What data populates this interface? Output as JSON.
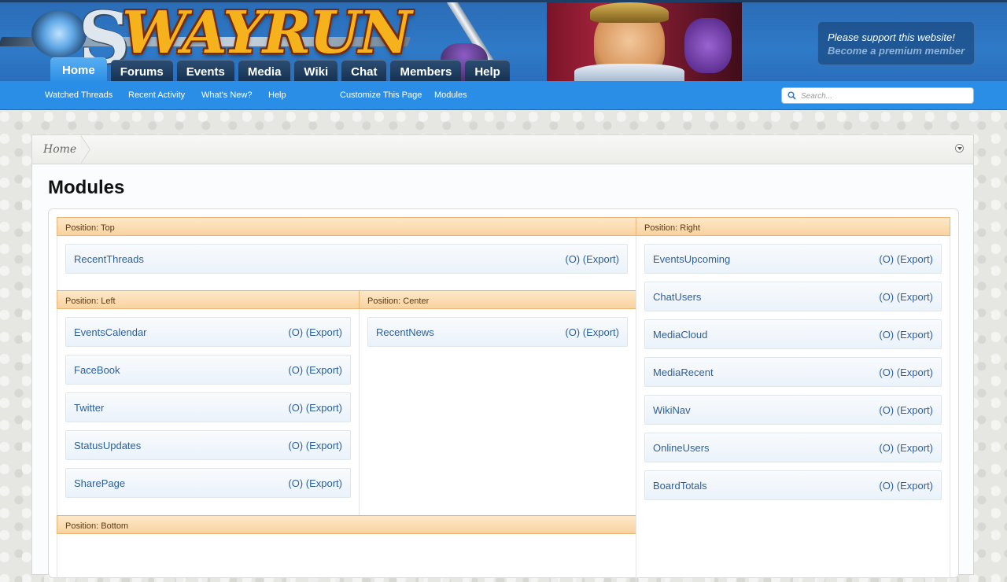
{
  "header": {
    "logo_text": "WAYRUN",
    "support_line1": "Please support this website!",
    "support_line2": "Become a premium member"
  },
  "tabs": [
    "Home",
    "Forums",
    "Events",
    "Media",
    "Wiki",
    "Chat",
    "Members",
    "Help"
  ],
  "subnav": {
    "links": [
      "Watched Threads",
      "Recent Activity",
      "What's New?",
      "Help",
      "Customize This Page",
      "Modules"
    ],
    "search_placeholder": "Search..."
  },
  "breadcrumb": {
    "home": "Home"
  },
  "page_title": "Modules",
  "action_labels": {
    "open": "(O)",
    "export": "(Export)"
  },
  "positions": {
    "top": {
      "label": "Position: Top",
      "modules": [
        "RecentThreads"
      ]
    },
    "left": {
      "label": "Position: Left",
      "modules": [
        "EventsCalendar",
        "FaceBook",
        "Twitter",
        "StatusUpdates",
        "SharePage"
      ]
    },
    "center": {
      "label": "Position: Center",
      "modules": [
        "RecentNews"
      ]
    },
    "right": {
      "label": "Position: Right",
      "modules": [
        "EventsUpcoming",
        "ChatUsers",
        "MediaCloud",
        "MediaRecent",
        "WikiNav",
        "OnlineUsers",
        "BoardTotals"
      ]
    },
    "bottom": {
      "label": "Position: Bottom",
      "modules": []
    }
  }
}
